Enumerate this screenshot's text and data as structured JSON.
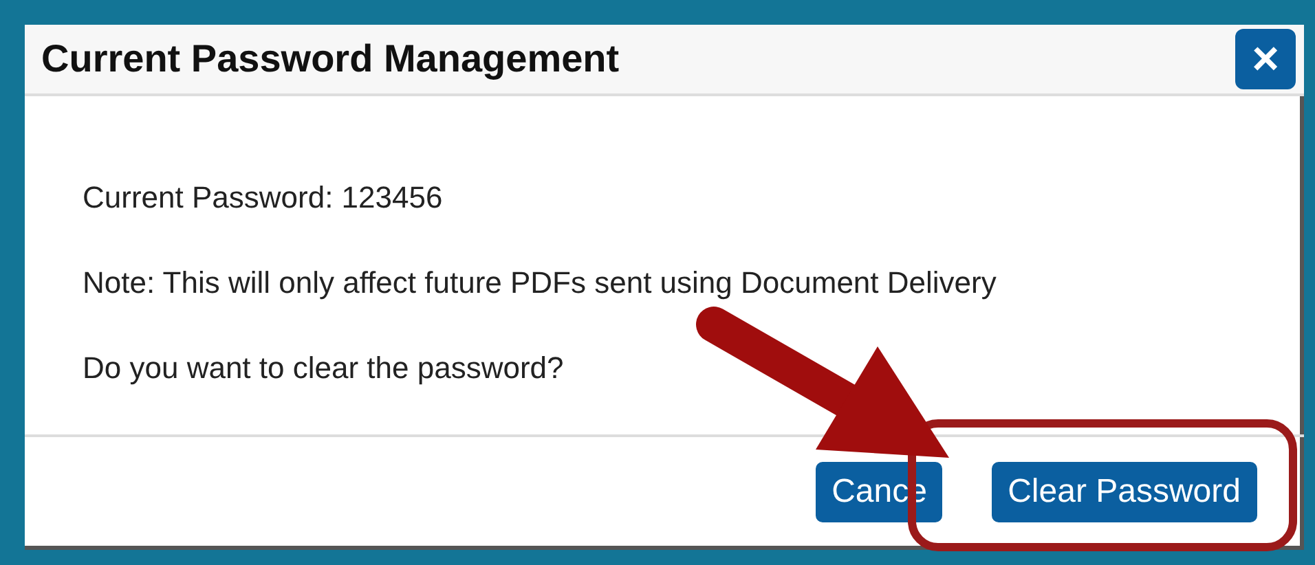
{
  "dialog": {
    "title": "Current Password Management",
    "close_label": "×",
    "lines": [
      "Current Password: 123456",
      "Note: This will only affect future PDFs sent using Document Delivery",
      "Do you want to clear the password?"
    ],
    "buttons": [
      {
        "label": "Cance",
        "kind": "secondary"
      },
      {
        "label": "Clear Password",
        "kind": "primary"
      }
    ]
  }
}
